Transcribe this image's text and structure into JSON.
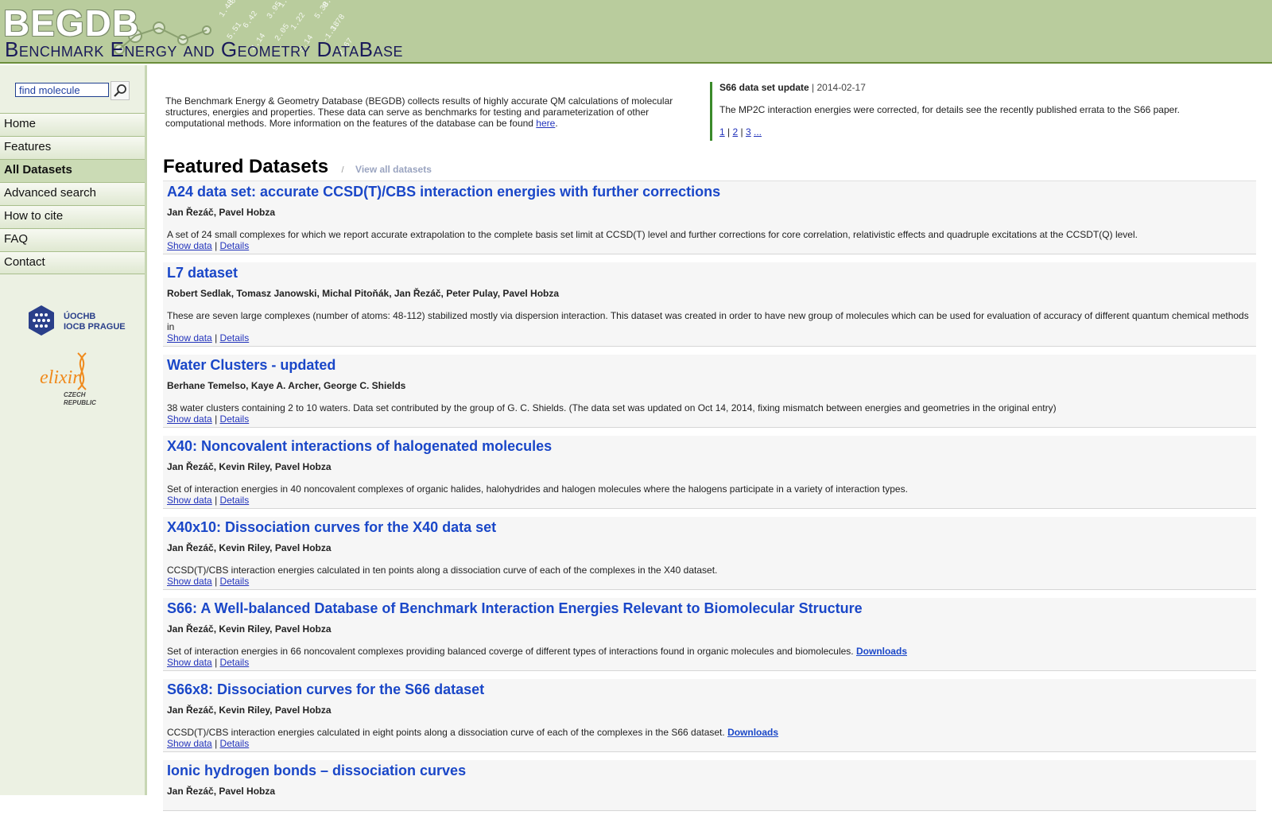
{
  "header": {
    "logo_title": "BEGDB",
    "logo_subtitle": "Benchmark Energy and Geometry DataBase",
    "art_numbers": [
      "-0.45",
      "1.80",
      "0.12",
      "1.48",
      "3.95",
      "5.38",
      "6.42",
      "1.22",
      "3.78",
      "5.51",
      "2.05",
      "-1.18",
      "4.14",
      "5.14",
      "2.67"
    ]
  },
  "search": {
    "placeholder": "find molecule",
    "value": "find molecule"
  },
  "nav": {
    "items": [
      {
        "label": "Home"
      },
      {
        "label": "Features"
      },
      {
        "label": "All Datasets"
      },
      {
        "label": "Advanced search"
      },
      {
        "label": "How to cite"
      },
      {
        "label": "FAQ"
      },
      {
        "label": "Contact"
      }
    ],
    "active": "All Datasets"
  },
  "logos": {
    "iocb_line1": "ÚOCHB",
    "iocb_line2": "IOCB PRAGUE",
    "elixir": "elixir",
    "elixir_line1": "CZECH",
    "elixir_line2": "REPUBLIC"
  },
  "intro": {
    "text": "The Benchmark Energy & Geometry Database (BEGDB) collects results of highly accurate QM calculations of molecular structures, energies and properties. These data can serve as benchmarks for testing and parameterization of other computational methods. More information on the features of the database can be found ",
    "link": "here",
    "end": "."
  },
  "news": {
    "title": "S66 data set update",
    "date": " | 2014-02-17",
    "body": "The MP2C interaction energies were corrected, for details see the recently published errata to the S66 paper.",
    "pages": [
      "1",
      "2",
      "3",
      "..."
    ]
  },
  "featured": {
    "title": "Featured Datasets",
    "sep": "/",
    "view_all": "View all datasets"
  },
  "datasets": [
    {
      "title": "A24 data set: accurate CCSD(T)/CBS interaction energies with further corrections",
      "authors": "Jan Řezáč, Pavel Hobza",
      "desc": "A set of 24 small complexes for which we report accurate extrapolation to the complete basis set limit at CCSD(T) level and further corrections for core correlation, relativistic effects and quadruple excitations at the CCSDT(Q) level.",
      "download": ""
    },
    {
      "title": "L7 dataset",
      "authors": "Robert Sedlak, Tomasz Janowski, Michal Pitoňák, Jan Řezáč, Peter Pulay, Pavel Hobza",
      "desc": "These are seven large complexes (number of atoms: 48-112) stabilized mostly via dispersion interaction. This dataset was created in order to have new group of molecules which can be used for evaluation of accuracy of different quantum chemical methods in",
      "download": ""
    },
    {
      "title": "Water Clusters - updated",
      "authors": "Berhane Temelso, Kaye A. Archer, George C. Shields",
      "desc": "38 water clusters containing 2 to 10 waters. Data set contributed by the group of G. C. Shields. (The data set was updated on Oct 14, 2014, fixing mismatch between energies and geometries in the original entry)",
      "download": ""
    },
    {
      "title": "X40: Noncovalent interactions of halogenated molecules",
      "authors": "Jan Řezáč, Kevin Riley, Pavel Hobza",
      "desc": "Set of interaction energies in 40 noncovalent complexes of organic halides, halohydrides and halogen molecules where the halogens participate in a variety of interaction types.",
      "download": ""
    },
    {
      "title": "X40x10: Dissociation curves for the X40 data set",
      "authors": "Jan Řezáč, Kevin Riley, Pavel Hobza",
      "desc": "CCSD(T)/CBS interaction energies calculated in ten points along a dissociation curve of each of the complexes in the X40 dataset.",
      "download": ""
    },
    {
      "title": "S66: A Well-balanced Database of Benchmark Interaction Energies Relevant to Biomolecular Structure",
      "authors": "Jan Řezáč, Kevin Riley, Pavel Hobza",
      "desc": "Set of interaction energies in 66 noncovalent complexes providing balanced coverge of different types of interactions found in organic molecules and biomolecules.",
      "download": "Downloads"
    },
    {
      "title": "S66x8: Dissociation curves for the S66 dataset",
      "authors": "Jan Řezáč, Kevin Riley, Pavel Hobza",
      "desc": "CCSD(T)/CBS interaction energies calculated in eight points along a dissociation curve of each of the complexes in the S66 dataset.",
      "download": "Downloads"
    },
    {
      "title": "Ionic hydrogen bonds – dissociation curves",
      "authors": "Jan Řezáč, Pavel Hobza",
      "desc": "",
      "download": ""
    }
  ],
  "dataset_links": {
    "show": "Show data",
    "sep": "|",
    "details": "Details"
  }
}
